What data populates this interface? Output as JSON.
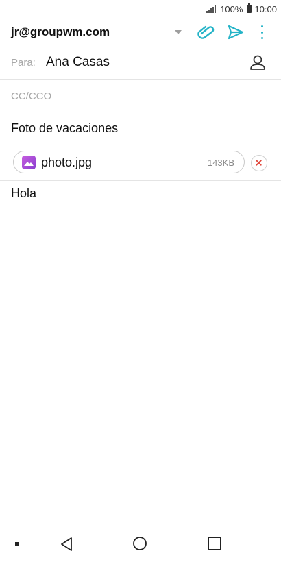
{
  "status": {
    "battery": "100%",
    "time": "10:00"
  },
  "toolbar": {
    "account": "jr@groupwm.com"
  },
  "compose": {
    "to_label": "Para:",
    "to_value": "Ana Casas",
    "cc_label": "CC/CCO",
    "subject": "Foto de vacaciones",
    "attachment": {
      "name": "photo.jpg",
      "size": "143KB"
    },
    "body": "Hola"
  },
  "colors": {
    "accent": "#23b3c7",
    "remove": "#e0473b",
    "attachment_icon": "#a64fd8"
  }
}
